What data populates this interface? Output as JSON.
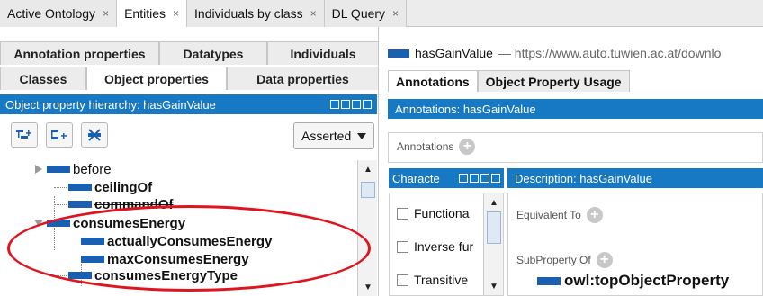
{
  "top_tabs": [
    {
      "label": "Active Ontology"
    },
    {
      "label": "Entities"
    },
    {
      "label": "Individuals by class"
    },
    {
      "label": "DL Query"
    }
  ],
  "close_glyph": "×",
  "left": {
    "subtabs_row1": [
      "Annotation properties",
      "Datatypes",
      "Individuals"
    ],
    "subtabs_row2": [
      "Classes",
      "Object properties",
      "Data properties"
    ],
    "hierarchy_title": "Object property hierarchy: hasGainValue",
    "asserted_label": "Asserted",
    "tree": [
      "before",
      "ceilingOf",
      "commandOf",
      "consumesEnergy",
      "actuallyConsumesEnergy",
      "maxConsumesEnergy",
      "consumesEnergyType"
    ]
  },
  "right": {
    "property_name": "hasGainValue",
    "property_url": "— https://www.auto.tuwien.ac.at/downlo",
    "tabs": [
      "Annotations",
      "Object Property Usage"
    ],
    "annotations_bar": "Annotations: hasGainValue",
    "annotations_label": "Annotations",
    "characteristics_bar": "Characte",
    "characteristics": [
      "Functiona",
      "Inverse fur",
      "Transitive"
    ],
    "description_bar": "Description: hasGainValue",
    "equivalent_to": "Equivalent To",
    "subproperty_of": "SubProperty Of",
    "top_object_property": "owl:topObjectProperty"
  },
  "colors": {
    "header_blue": "#1779c4",
    "entity_blue": "#1a5fb0",
    "highlight_red": "#e0141e"
  }
}
